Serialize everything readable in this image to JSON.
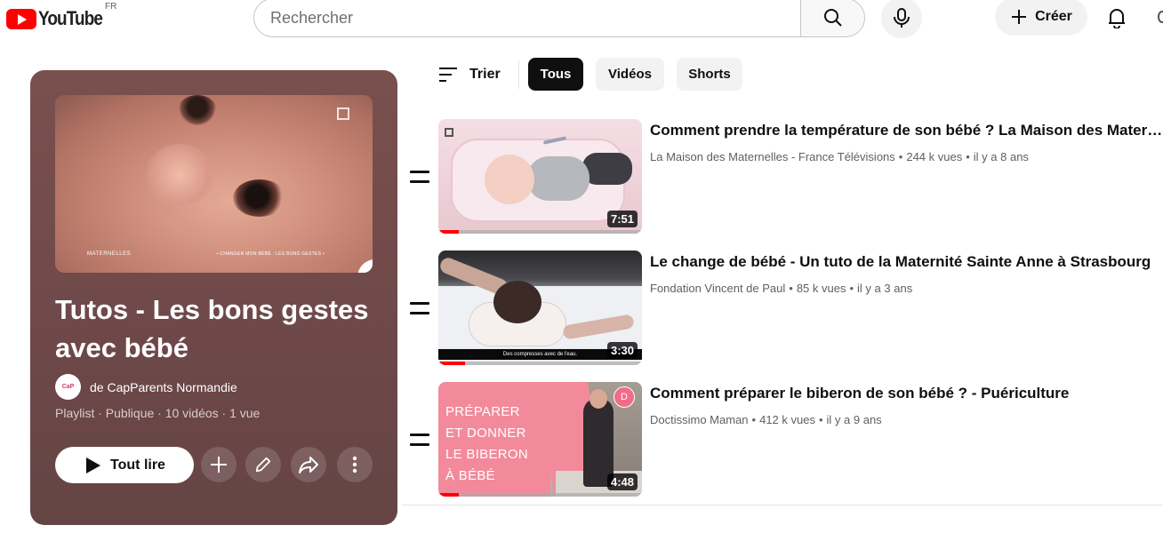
{
  "header": {
    "logo_text": "YouTube",
    "country_code": "FR",
    "search_placeholder": "Rechercher",
    "create_label": "Créer"
  },
  "playlist": {
    "title": "Tutos - Les bons gestes avec bébé",
    "owner": "de CapParents Normandie",
    "meta": "Playlist · Publique · 10 vidéos · 1 vue",
    "play_all_label": "Tout lire",
    "thumb_band_text": "• CHANGER MON BÉBÉ : LES BONS GESTES •",
    "thumb_brand": "MATERNELLES"
  },
  "filters": {
    "sort_label": "Trier",
    "chips": [
      {
        "label": "Tous",
        "active": true
      },
      {
        "label": "Vidéos",
        "active": false
      },
      {
        "label": "Shorts",
        "active": false
      }
    ]
  },
  "videos": [
    {
      "title": "Comment prendre la température de son bébé ? La Maison des Maternelles",
      "channel": "La Maison des Maternelles - France Télévisions",
      "views": "244 k vues",
      "age": "il y a 8 ans",
      "duration": "7:51",
      "progress_fraction": 0.1
    },
    {
      "title": "Le change de bébé - Un tuto de la Maternité Sainte Anne à Strasbourg",
      "channel": "Fondation Vincent de Paul",
      "views": "85 k vues",
      "age": "il y a 3 ans",
      "duration": "3:30",
      "progress_fraction": 0.13,
      "thumb_caption": "Des compresses avec de l'eau."
    },
    {
      "title": "Comment préparer le biberon de son bébé ? - Puériculture",
      "channel": "Doctissimo Maman",
      "views": "412 k vues",
      "age": "il y a 9 ans",
      "duration": "4:48",
      "progress_fraction": 0.1,
      "thumb_text": "PRÉPARER ET DONNER LE BIBERON À BÉBÉ",
      "thumb_badge": "D"
    }
  ],
  "colors": {
    "brand_red": "#ff0000",
    "playlist_card": "#70494a",
    "chip_active": "#0f0f0f"
  },
  "icons": [
    "search-icon",
    "microphone-icon",
    "plus-icon",
    "bell-icon",
    "sort-icon",
    "pencil-icon",
    "play-icon",
    "share-icon",
    "more-vertical-icon",
    "drag-handle-icon"
  ]
}
